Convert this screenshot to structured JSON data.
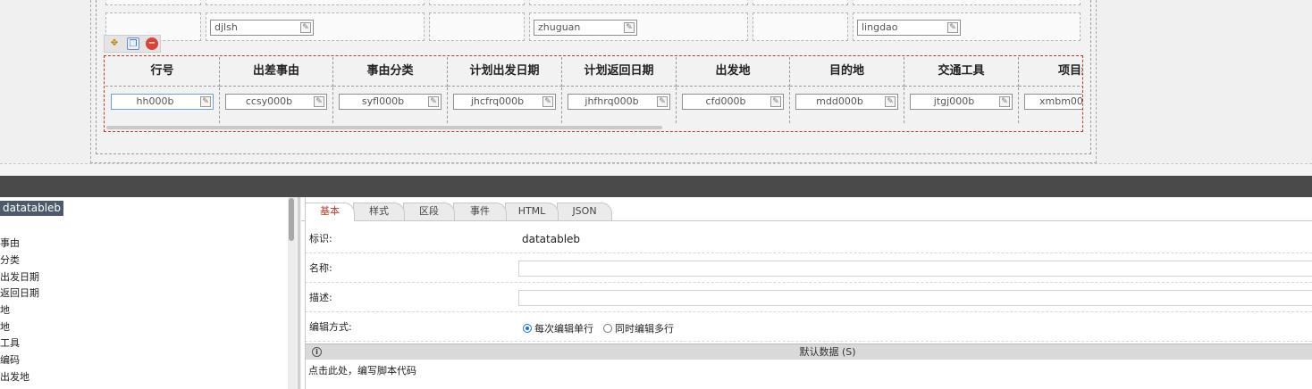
{
  "form": {
    "row2_fields": [
      {
        "value": "djlsh"
      },
      {
        "value": "zhuguan"
      },
      {
        "value": "lingdao"
      }
    ]
  },
  "mini_toolbar": {
    "icons": [
      "move-icon",
      "copy-icon",
      "delete-icon"
    ]
  },
  "datatable": {
    "headers": [
      "行号",
      "出差事由",
      "事由分类",
      "计划出发日期",
      "计划返回日期",
      "出发地",
      "目的地",
      "交通工具",
      "项目编"
    ],
    "fields": [
      "hh000b",
      "ccsy000b",
      "syfl000b",
      "jhcfrq000b",
      "jhfhrq000b",
      "cfd000b",
      "mdd000b",
      "jtgj000b",
      "xmbm00"
    ]
  },
  "tree": {
    "root": "datatableb",
    "items": [
      "事由",
      "分类",
      "出发日期",
      "返回日期",
      "地",
      "地",
      "工具",
      "编码",
      "出发地"
    ]
  },
  "props": {
    "tabs": [
      "基本",
      "样式",
      "区段",
      "事件",
      "HTML",
      "JSON"
    ],
    "active_tab": "基本",
    "id_label": "标识:",
    "id_value": "datatableb",
    "name_label": "名称:",
    "name_value": "",
    "desc_label": "描述:",
    "desc_value": "",
    "edit_mode_label": "编辑方式:",
    "edit_mode_options": [
      "每次编辑单行",
      "同时编辑多行"
    ],
    "edit_mode_selected": "每次编辑单行",
    "default_data_title": "默认数据 (S)",
    "script_hint": "点击此处，编写脚本代码"
  },
  "colors": {
    "accent": "#c0392b",
    "dark_bar": "#4a4a4a",
    "tree_selected": "#4d5a6e",
    "radio_on": "#1e6fd9"
  }
}
